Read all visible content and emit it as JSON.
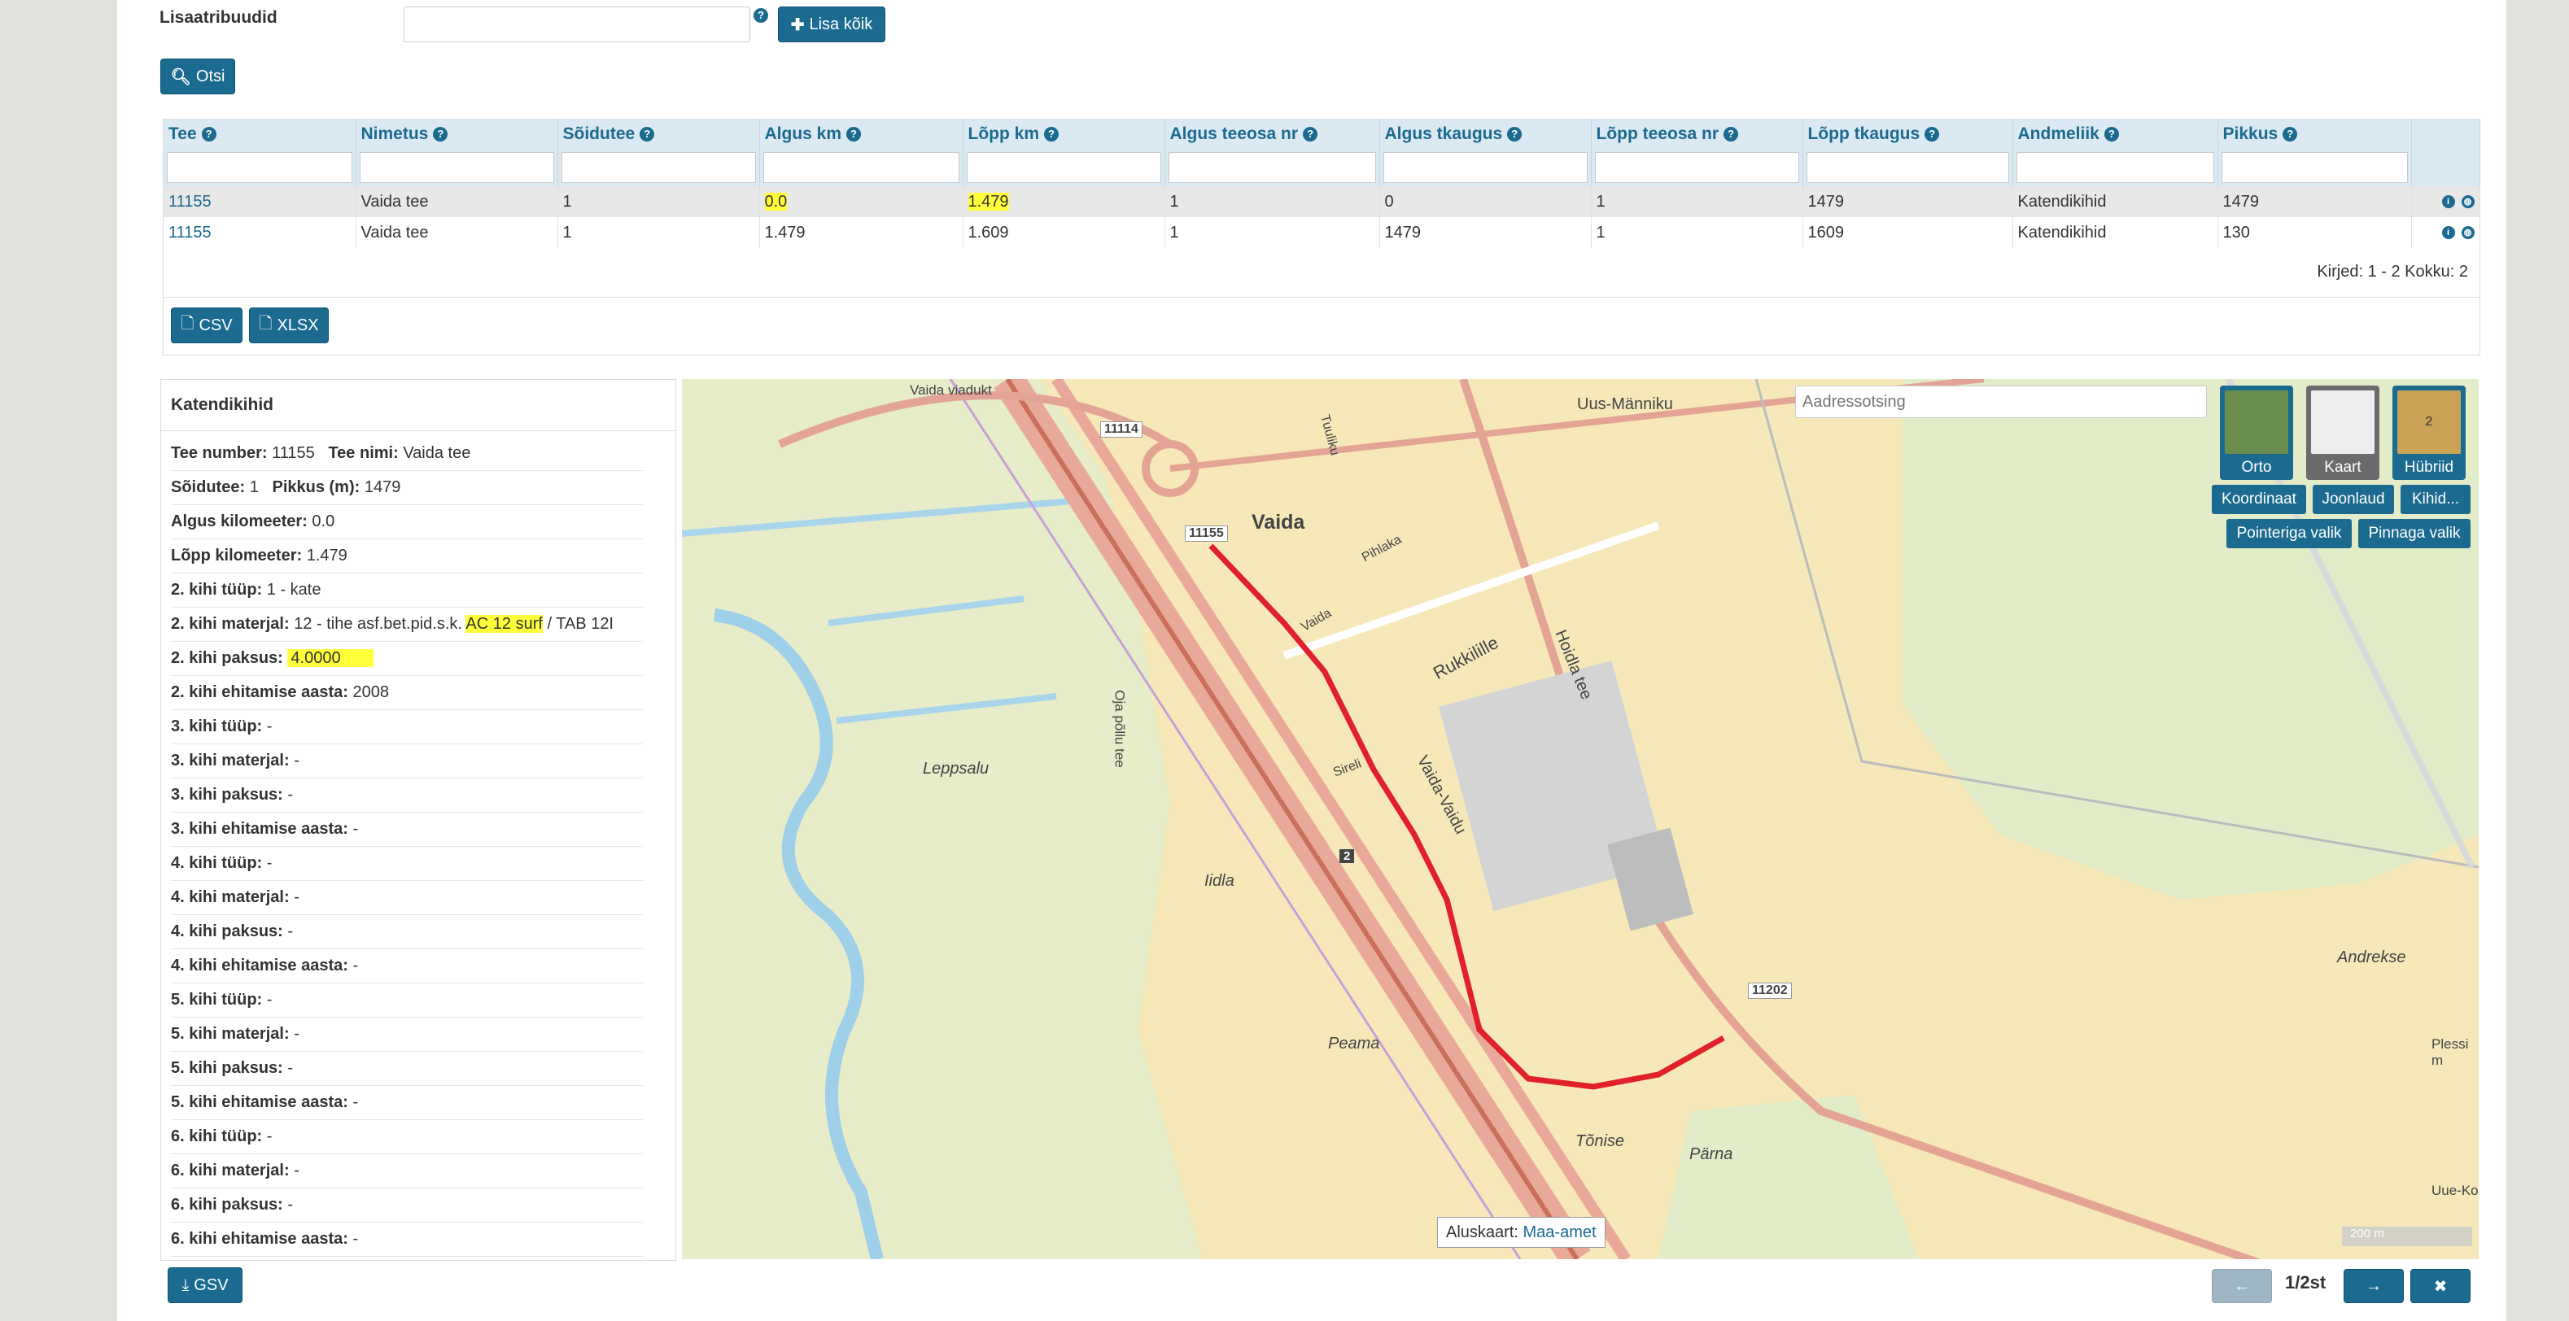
{
  "form": {
    "extra_attr_label": "Lisaatribuudid",
    "extra_attr_value": "",
    "add_all_label": "Lisa kõik",
    "search_label": "Otsi"
  },
  "table": {
    "headers": [
      "Tee",
      "Nimetus",
      "Sõidutee",
      "Algus km",
      "Lõpp km",
      "Algus teeosa nr",
      "Algus tkaugus",
      "Lõpp teeosa nr",
      "Lõpp tkaugus",
      "Andmeliik",
      "Pikkus"
    ],
    "rows": [
      [
        "11155",
        "Vaida tee",
        "1",
        "0.0",
        "1.479",
        "1",
        "0",
        "1",
        "1479",
        "Katendikihid",
        "1479"
      ],
      [
        "11155",
        "Vaida tee",
        "1",
        "1.479",
        "1.609",
        "1",
        "1479",
        "1",
        "1609",
        "Katendikihid",
        "130"
      ]
    ],
    "pager_text": "Kirjed: 1 - 2 Kokku: 2",
    "csv_label": "CSV",
    "xlsx_label": "XLSX"
  },
  "panel": {
    "title": "Katendikihid",
    "lines": [
      {
        "k1": "Tee number:",
        "v1": "11155",
        "k2": "Tee nimi:",
        "v2": "Vaida tee"
      },
      {
        "k1": "Sõidutee:",
        "v1": "1",
        "k2": "Pikkus (m):",
        "v2": "1479"
      },
      {
        "k1": "Algus kilomeeter:",
        "v1": "0.0"
      },
      {
        "k1": "Lõpp kilomeeter:",
        "v1": "1.479"
      },
      {
        "k1": "2. kihi tüüp:",
        "v1": "1 - kate"
      },
      {
        "k1": "2. kihi materjal:",
        "v1": "12 - tihe asf.bet.pid.s.k.",
        "hl": "AC 12 surf",
        "tail": "/ TAB 12I"
      },
      {
        "k1": "2. kihi paksus:",
        "hl": "4.0000"
      },
      {
        "k1": "2. kihi ehitamise aasta:",
        "v1": "2008"
      },
      {
        "k1": "3. kihi tüüp:",
        "v1": "-"
      },
      {
        "k1": "3. kihi materjal:",
        "v1": "-"
      },
      {
        "k1": "3. kihi paksus:",
        "v1": "-"
      },
      {
        "k1": "3. kihi ehitamise aasta:",
        "v1": "-"
      },
      {
        "k1": "4. kihi tüüp:",
        "v1": "-"
      },
      {
        "k1": "4. kihi materjal:",
        "v1": "-"
      },
      {
        "k1": "4. kihi paksus:",
        "v1": "-"
      },
      {
        "k1": "4. kihi ehitamise aasta:",
        "v1": "-"
      },
      {
        "k1": "5. kihi tüüp:",
        "v1": "-"
      },
      {
        "k1": "5. kihi materjal:",
        "v1": "-"
      },
      {
        "k1": "5. kihi paksus:",
        "v1": "-"
      },
      {
        "k1": "5. kihi ehitamise aasta:",
        "v1": "-"
      },
      {
        "k1": "6. kihi tüüp:",
        "v1": "-"
      },
      {
        "k1": "6. kihi materjal:",
        "v1": "-"
      },
      {
        "k1": "6. kihi paksus:",
        "v1": "-"
      },
      {
        "k1": "6. kihi ehitamise aasta:",
        "v1": "-"
      }
    ],
    "gsv_label": "GSV"
  },
  "map": {
    "address_placeholder": "Aadressotsing",
    "layers": [
      "Orto",
      "Kaart",
      "Hübriid"
    ],
    "hybrid_badge": "2",
    "tools": [
      "Koordinaat",
      "Joonlaud",
      "Kihid..."
    ],
    "select_tools": [
      "Pointeriga valik",
      "Pinnaga valik"
    ],
    "basemap_label": "Aluskaart:",
    "basemap_link": "Maa-amet",
    "scale": "200 m",
    "places": [
      "Vaida",
      "Uus-Männiku",
      "Leppsalu",
      "Iidla",
      "Peama",
      "Tõnise",
      "Pärna",
      "Andrekse",
      "Vaida viadukt",
      "Rukkilille",
      "Hoidla tee",
      "Vaida-Vaidu",
      "Oja põllu tee",
      "Uue-Ko",
      "Plessi m",
      "Pihlaka",
      "Vaida",
      "Sireli",
      "Tuuliku"
    ],
    "road_numbers": [
      "11114",
      "11155",
      "11202",
      "2"
    ]
  },
  "footer": {
    "page_indicator": "1/2st"
  },
  "colors": {
    "accent": "#1b6a8f",
    "highlight": "#ffff3a",
    "route": "#e0202a"
  }
}
